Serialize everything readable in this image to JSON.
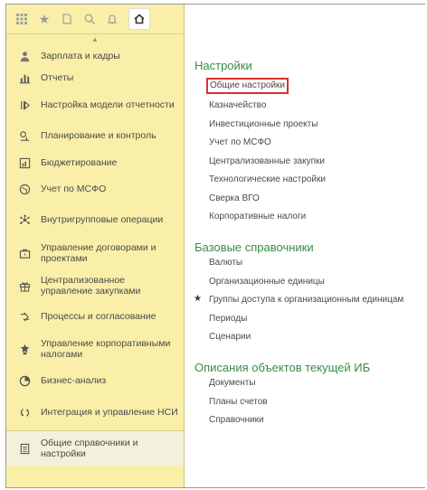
{
  "toolbar": {
    "buttons": [
      "apps-grid-icon",
      "star-icon",
      "history-icon",
      "search-icon",
      "bell-icon",
      "home-icon"
    ]
  },
  "sidebar": {
    "items": [
      {
        "label": "Зарплата и кадры",
        "icon": "person-icon"
      },
      {
        "label": "Отчеты",
        "icon": "bar-chart-icon"
      },
      {
        "label": "Настройка модели отчетности",
        "icon": "model-icon"
      },
      {
        "label": "Планирование и контроль",
        "icon": "planning-icon"
      },
      {
        "label": "Бюджетирование",
        "icon": "budget-icon"
      },
      {
        "label": "Учет по МСФО",
        "icon": "globe-icon"
      },
      {
        "label": "Внутригрупповые операции",
        "icon": "network-icon"
      },
      {
        "label": "Управление договорами и проектами",
        "icon": "briefcase-icon"
      },
      {
        "label": "Централизованное управление закупками",
        "icon": "gift-icon"
      },
      {
        "label": "Процессы и согласование",
        "icon": "process-icon"
      },
      {
        "label": "Управление корпоративными налогами",
        "icon": "tax-icon"
      },
      {
        "label": "Бизнес-анализ",
        "icon": "pie-icon"
      },
      {
        "label": "Интеграция и управление НСИ",
        "icon": "sync-icon"
      },
      {
        "label": "Общие справочники и настройки",
        "icon": "document-icon"
      }
    ]
  },
  "main": {
    "sections": [
      {
        "title": "Настройки",
        "links": [
          "Общие настройки",
          "Казначейство",
          "Инвестиционные проекты",
          "Учет по МСФО",
          "Централизованные закупки",
          "Технологические настройки",
          "Сверка ВГО",
          "Корпоративные налоги"
        ]
      },
      {
        "title": "Базовые справочники",
        "links": [
          "Валюты",
          "Организационные единицы",
          "Группы доступа к организационным единицам",
          "Периоды",
          "Сценарии"
        ]
      },
      {
        "title": "Описания объектов текущей ИБ",
        "links": [
          "Документы",
          "Планы счетов",
          "Справочники"
        ]
      }
    ]
  },
  "colors": {
    "sidebar_bg": "#f9efa8",
    "section_title": "#3a8b45",
    "highlight_border": "#d9302c"
  }
}
